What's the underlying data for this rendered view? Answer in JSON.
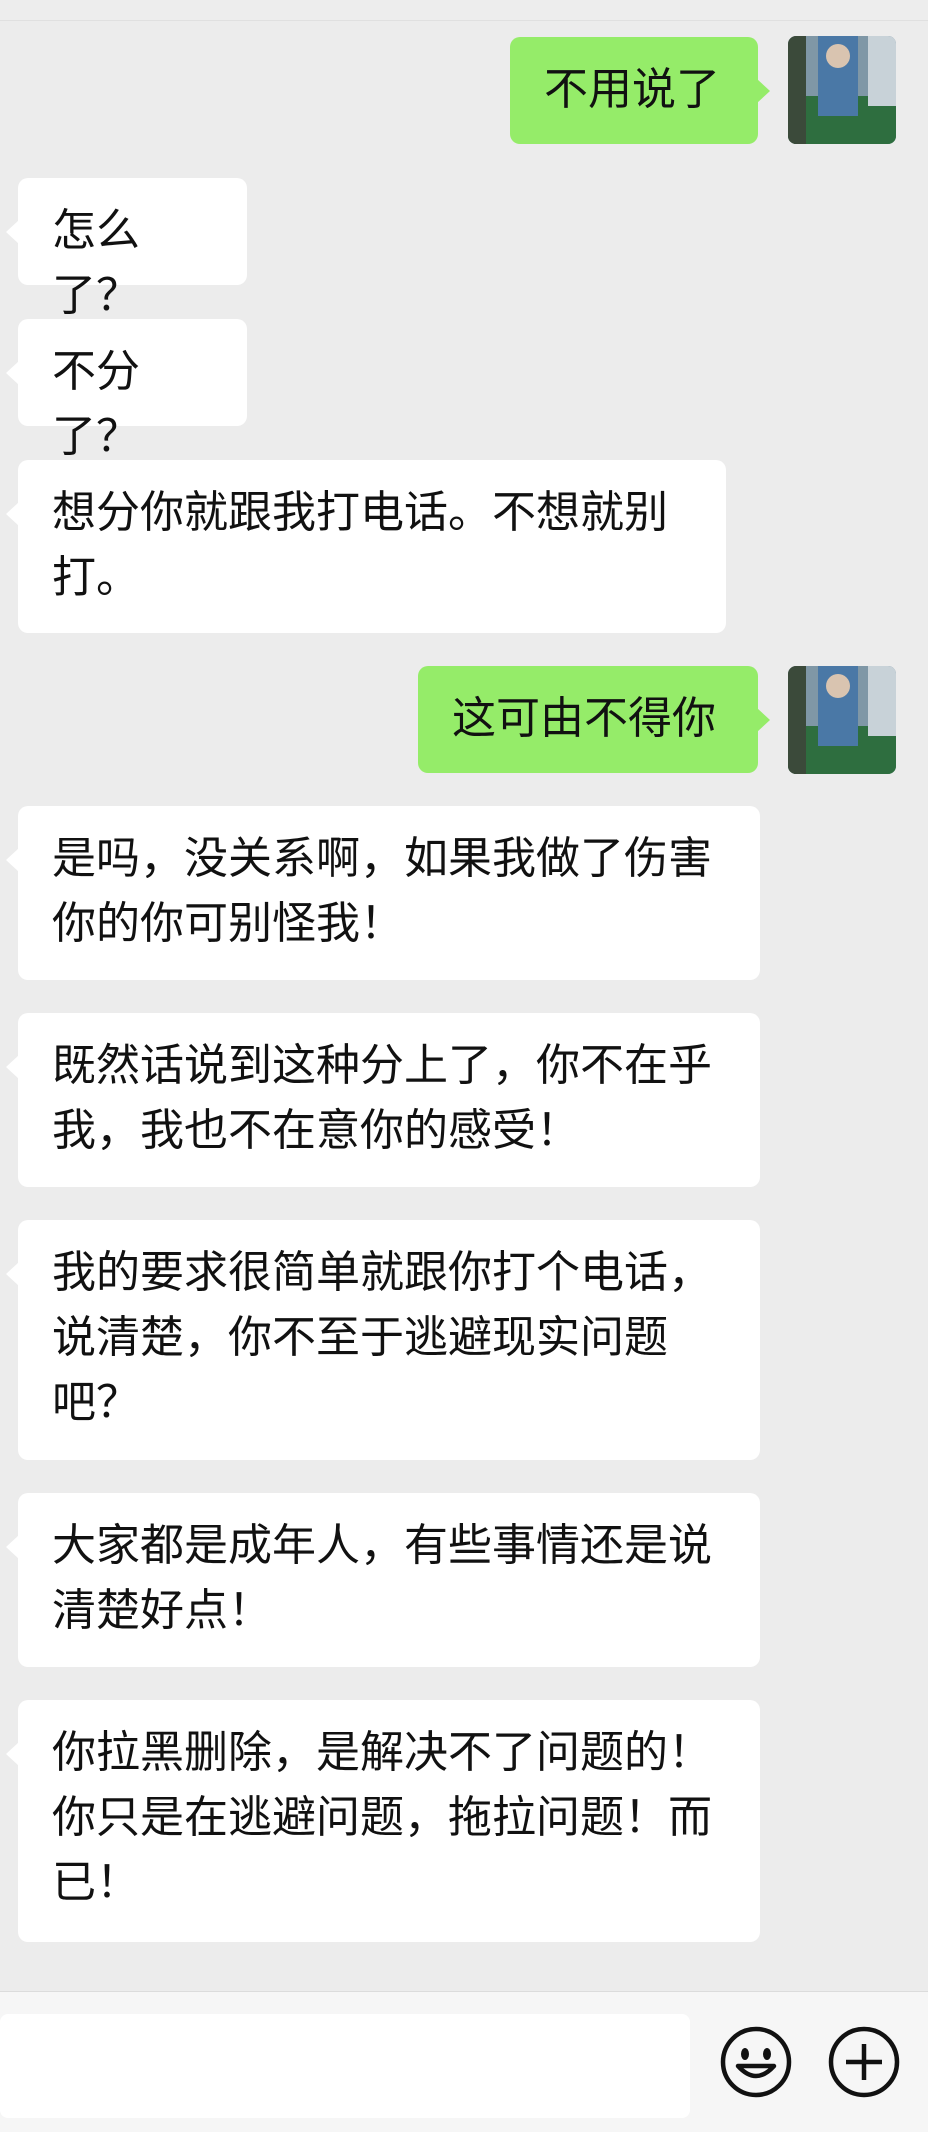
{
  "chat": {
    "messages": [
      {
        "side": "out",
        "text": "不用说了"
      },
      {
        "side": "in",
        "text": "怎么了？"
      },
      {
        "side": "in",
        "text": "不分了？"
      },
      {
        "side": "in",
        "text": "想分你就跟我打电话。不想就别\n打。"
      },
      {
        "side": "out",
        "text": "这可由不得你"
      },
      {
        "side": "in",
        "text": "是吗，没关系啊，如果我做了伤害\n你的你可别怪我！"
      },
      {
        "side": "in",
        "text": "既然话说到这种分上了，你不在乎\n我，我也不在意你的感受！"
      },
      {
        "side": "in",
        "text": "我的要求很简单就跟你打个电话，\n说清楚，你不至于逃避现实问题\n吧？"
      },
      {
        "side": "in",
        "text": "大家都是成年人，有些事情还是说\n清楚好点！"
      },
      {
        "side": "in",
        "text": "你拉黑删除，是解决不了问题的！\n你只是在逃避问题，拖拉问题！而\n已！"
      }
    ]
  },
  "input_bar": {
    "input_value": "",
    "emoji_icon": "emoji-icon",
    "plus_icon": "plus-circle-icon"
  },
  "colors": {
    "background": "#ececec",
    "incoming_bubble": "#ffffff",
    "outgoing_bubble": "#95ec69"
  }
}
